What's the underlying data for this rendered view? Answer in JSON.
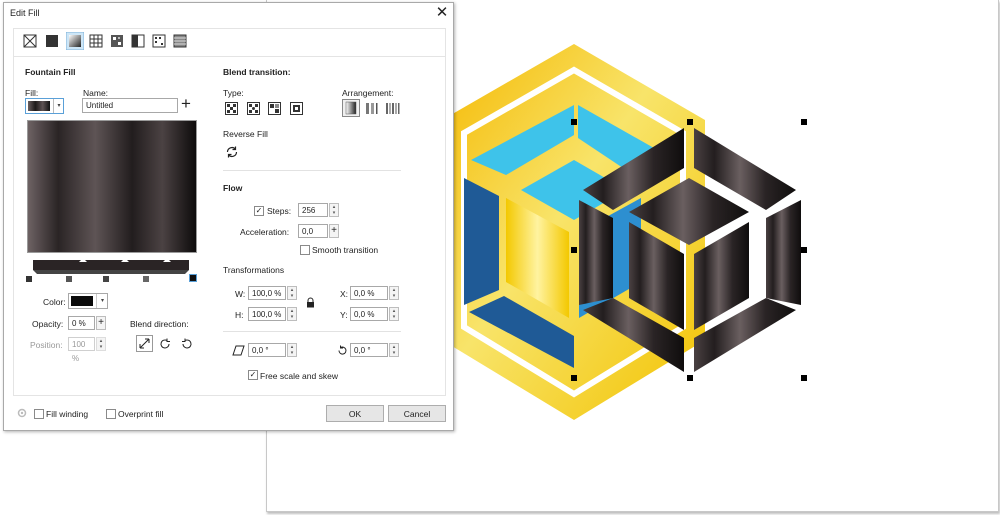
{
  "dialog": {
    "title": "Edit Fill",
    "toolbar_icons": [
      "no-fill-icon",
      "uniform-fill-icon",
      "fountain-fill-icon",
      "vector-pattern-fill-icon",
      "bitmap-pattern-fill-icon",
      "two-color-pattern-fill-icon",
      "texture-fill-icon",
      "postscript-fill-icon"
    ]
  },
  "left": {
    "heading": "Fountain Fill",
    "fill_label": "Fill:",
    "name_label": "Name:",
    "name_value": "Untitled",
    "color_label": "Color:",
    "color_value": "#0a0a0a",
    "opacity_label": "Opacity:",
    "opacity_value": "0 %",
    "position_label": "Position:",
    "position_value": "100 %",
    "blend_direction_label": "Blend direction:"
  },
  "right": {
    "blend_heading": "Blend transition:",
    "type_label": "Type:",
    "arrangement_label": "Arrangement:",
    "reverse_label": "Reverse Fill",
    "flow_heading": "Flow",
    "steps_label": "Steps:",
    "steps_value": "256",
    "acceleration_label": "Acceleration:",
    "acceleration_value": "0,0",
    "smooth_label": "Smooth transition",
    "transform_heading": "Transformations",
    "w_label": "W:",
    "w_value": "100,0 %",
    "h_label": "H:",
    "h_value": "100,0 %",
    "x_label": "X:",
    "x_value": "0,0 %",
    "y_label": "Y:",
    "y_value": "0,0 %",
    "skew_value": "0,0 °",
    "rotate_value": "0,0 °",
    "free_scale_label": "Free scale and skew"
  },
  "footer": {
    "fill_winding_label": "Fill winding",
    "overprint_label": "Overprint fill",
    "ok_label": "OK",
    "cancel_label": "Cancel"
  },
  "colors": {
    "gold": "#f2c500",
    "light_blue": "#3ec3ea",
    "dark_blue": "#1f5a96",
    "mid_blue": "#2d8fd0",
    "dark_fill": "#1e1a1a"
  }
}
